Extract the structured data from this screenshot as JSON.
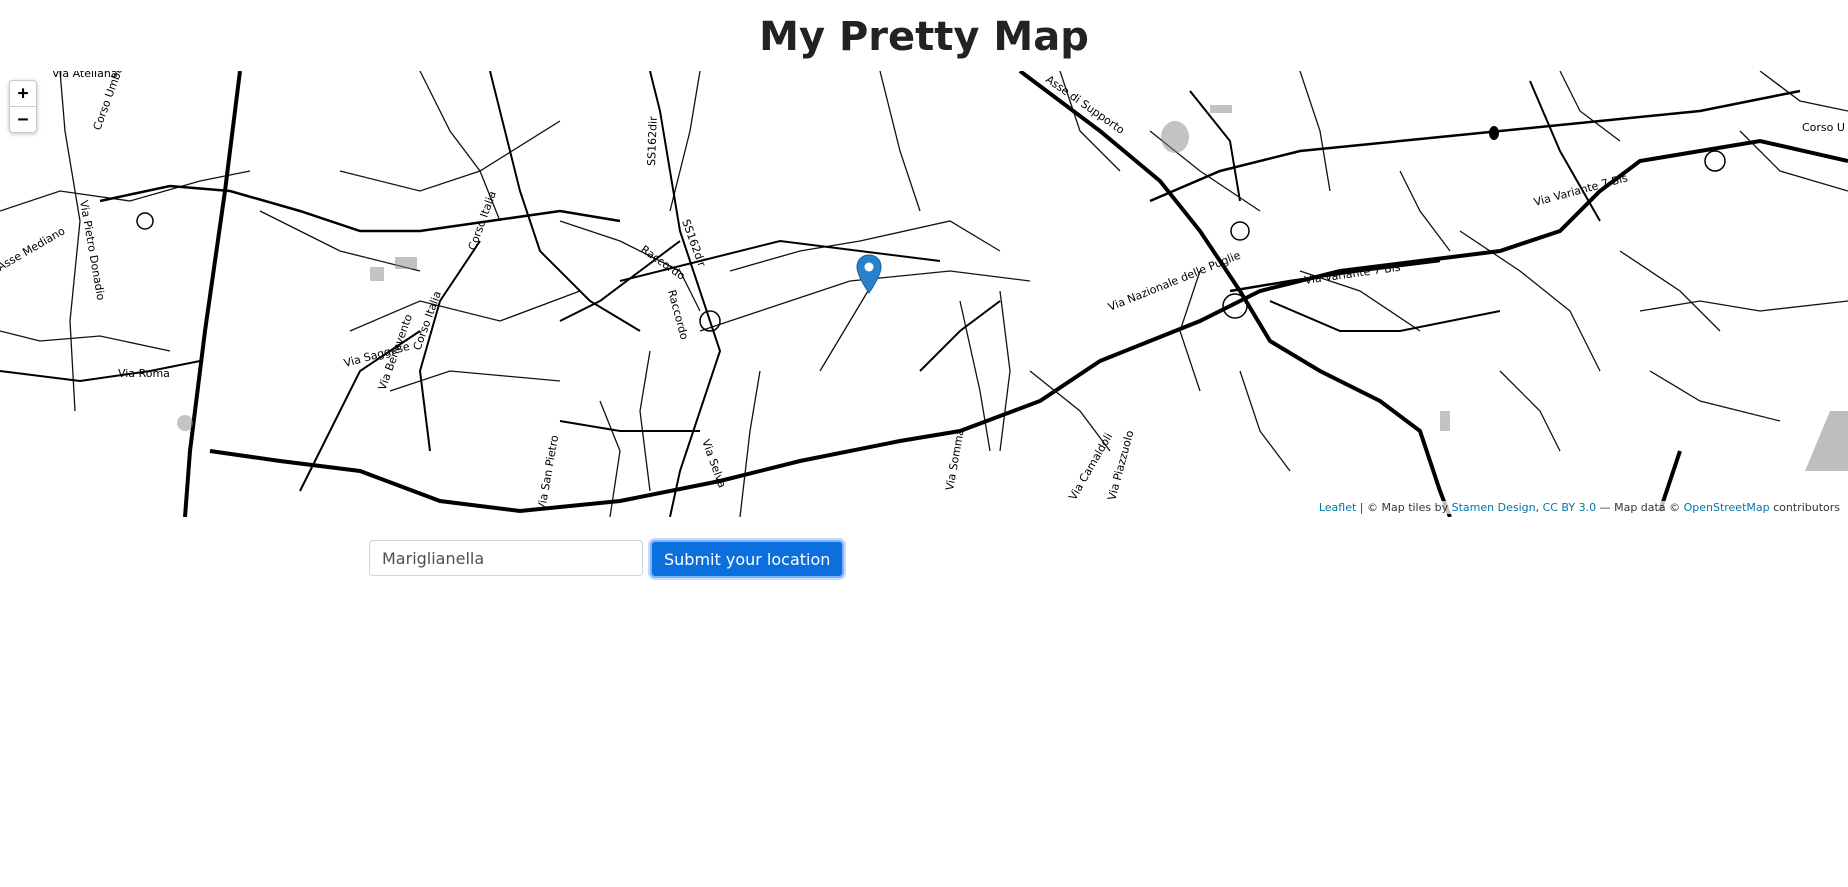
{
  "page": {
    "title": "My Pretty Map"
  },
  "map": {
    "zoom_in_label": "+",
    "zoom_out_label": "−",
    "marker_color": "#2a81cb",
    "attribution": {
      "leaflet_link": "Leaflet",
      "separator": " | © Map tiles by ",
      "stamen_link": "Stamen Design",
      "comma": ", ",
      "license_link": "CC BY 3.0",
      "data_text": " — Map data © ",
      "osm_link": "OpenStreetMap",
      "contributors": " contributors"
    },
    "road_labels": [
      "Via Ateliana",
      "Corso Umberto I",
      "Via Pietro Donadio",
      "Via Roma",
      "Corso Italia",
      "Via Saggese",
      "Via Benevento",
      "SS162dir",
      "Raccordo",
      "Via Selva",
      "Via San Pietro",
      "Via Somma",
      "Via Camaldoli",
      "Via Piazzuolo",
      "Via Nazionale delle Puglie",
      "Via Variante 7 Bis",
      "Asse di Supporto",
      "Corso U",
      "Asse Mediano"
    ]
  },
  "form": {
    "location_value": "Mariglianella",
    "submit_label": "Submit your location"
  }
}
